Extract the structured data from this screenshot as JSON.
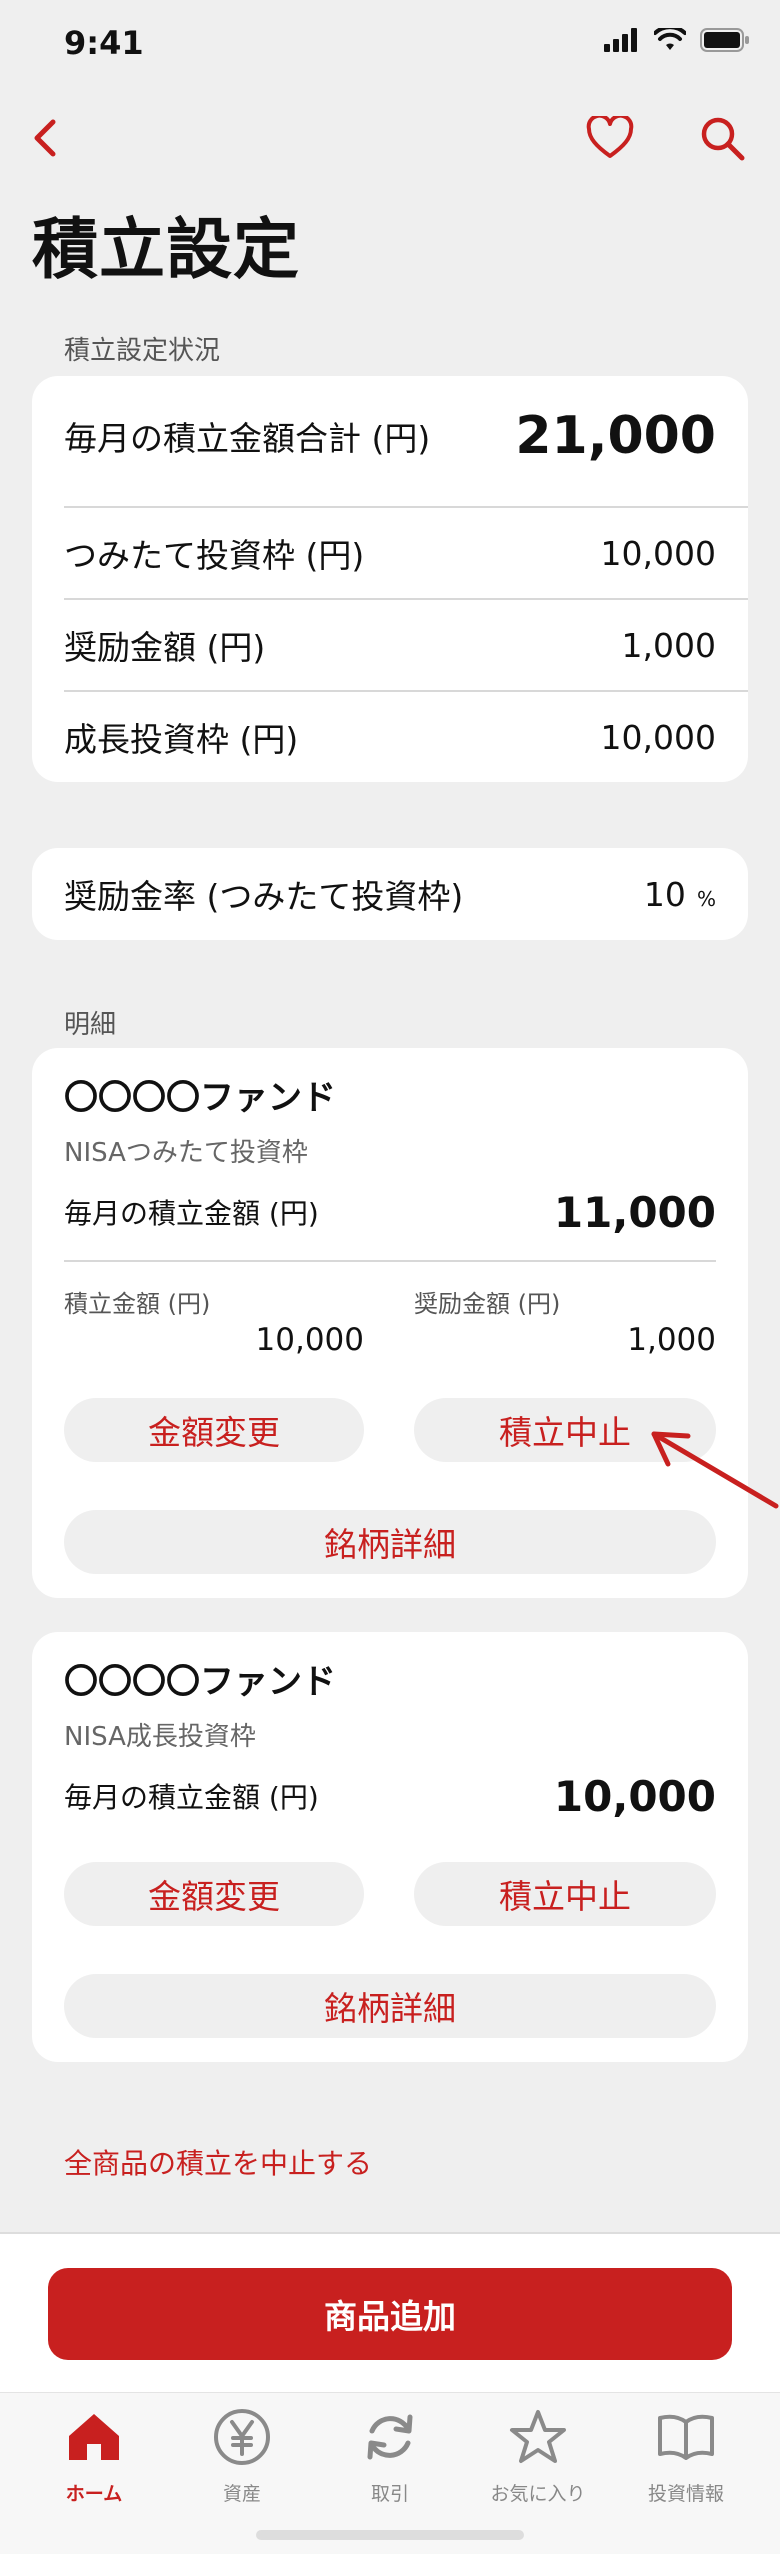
{
  "status_bar": {
    "time": "9:41"
  },
  "page": {
    "title": "積立設定"
  },
  "summary": {
    "section_label": "積立設定状況",
    "total_label": "毎月の積立金額合計 (円)",
    "total_value": "21,000",
    "rows": [
      {
        "label": "つみたて投資枠 (円)",
        "value": "10,000"
      },
      {
        "label": "奨励金額 (円)",
        "value": "1,000"
      },
      {
        "label": "成長投資枠 (円)",
        "value": "10,000"
      }
    ]
  },
  "incentive_rate": {
    "label": "奨励金率 (つみたて投資枠)",
    "value": "10",
    "unit": "%"
  },
  "details": {
    "section_label": "明細",
    "funds": [
      {
        "name": "〇〇〇〇ファンド",
        "type": "NISAつみたて投資枠",
        "monthly_label": "毎月の積立金額 (円)",
        "monthly_value": "11,000",
        "sub_amount_label": "積立金額 (円)",
        "sub_amount_value": "10,000",
        "sub_incentive_label": "奨励金額 (円)",
        "sub_incentive_value": "1,000",
        "change_label": "金額変更",
        "stop_label": "積立中止",
        "detail_label": "銘柄詳細"
      },
      {
        "name": "〇〇〇〇ファンド",
        "type": "NISA成長投資枠",
        "monthly_label": "毎月の積立金額 (円)",
        "monthly_value": "10,000",
        "change_label": "金額変更",
        "stop_label": "積立中止",
        "detail_label": "銘柄詳細"
      }
    ]
  },
  "stop_all_label": "全商品の積立を中止する",
  "add_button_label": "商品追加",
  "tabs": [
    {
      "label": "ホーム",
      "icon": "home-icon"
    },
    {
      "label": "資産",
      "icon": "yen-icon"
    },
    {
      "label": "取引",
      "icon": "refresh-icon"
    },
    {
      "label": "お気に入り",
      "icon": "star-icon"
    },
    {
      "label": "投資情報",
      "icon": "book-icon"
    }
  ],
  "colors": {
    "accent": "#c8201f",
    "background": "#efefef",
    "card": "#ffffff"
  }
}
